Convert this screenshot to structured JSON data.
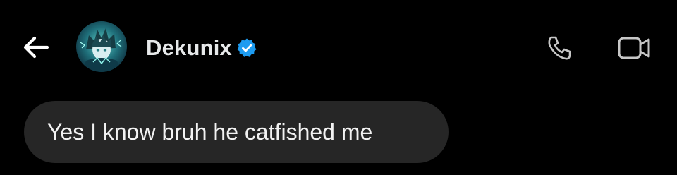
{
  "header": {
    "contact_name": "Dekunix",
    "verified": true,
    "verified_badge_color": "#1d9bf0",
    "icons": {
      "back": "arrow-left-icon",
      "verified": "verified-badge-icon",
      "call": "phone-icon",
      "video": "video-camera-icon"
    }
  },
  "messages": [
    {
      "direction": "incoming",
      "text": "Yes I know bruh he catfished me"
    }
  ],
  "colors": {
    "background": "#000000",
    "bubble_incoming": "#262626",
    "text": "#f2f2f2"
  }
}
